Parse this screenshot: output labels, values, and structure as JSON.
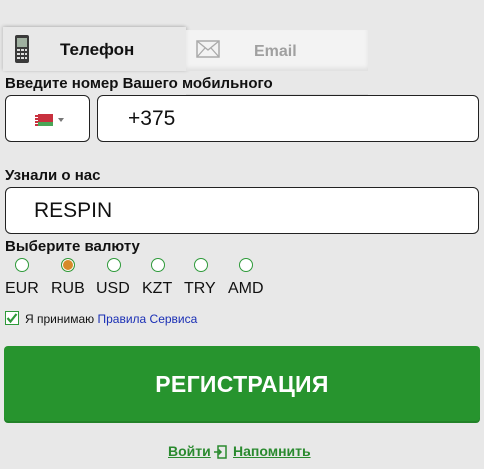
{
  "tabs": {
    "phone_label": "Телефон",
    "email_label": "Email"
  },
  "form": {
    "phone_label": "Введите номер Вашего мобильного",
    "country_flag": "belarus-flag",
    "phone_value": "+375",
    "referral_label": "Узнали о нас",
    "referral_value": "RESPIN",
    "currency_label": "Выберите валюту",
    "currencies": [
      "EUR",
      "RUB",
      "USD",
      "KZT",
      "TRY",
      "AMD"
    ],
    "selected_currency": "RUB",
    "agree_text": "Я принимаю",
    "terms_link": "Правила Сервиса",
    "agree_checked": true
  },
  "actions": {
    "register_label": "РЕГИСТРАЦИЯ",
    "login_label": "Войти",
    "remind_label": "Напомнить"
  },
  "colors": {
    "accent_green": "#27942e",
    "link_blue": "#1a2fb5",
    "selected_radio": "#d78a2a"
  }
}
